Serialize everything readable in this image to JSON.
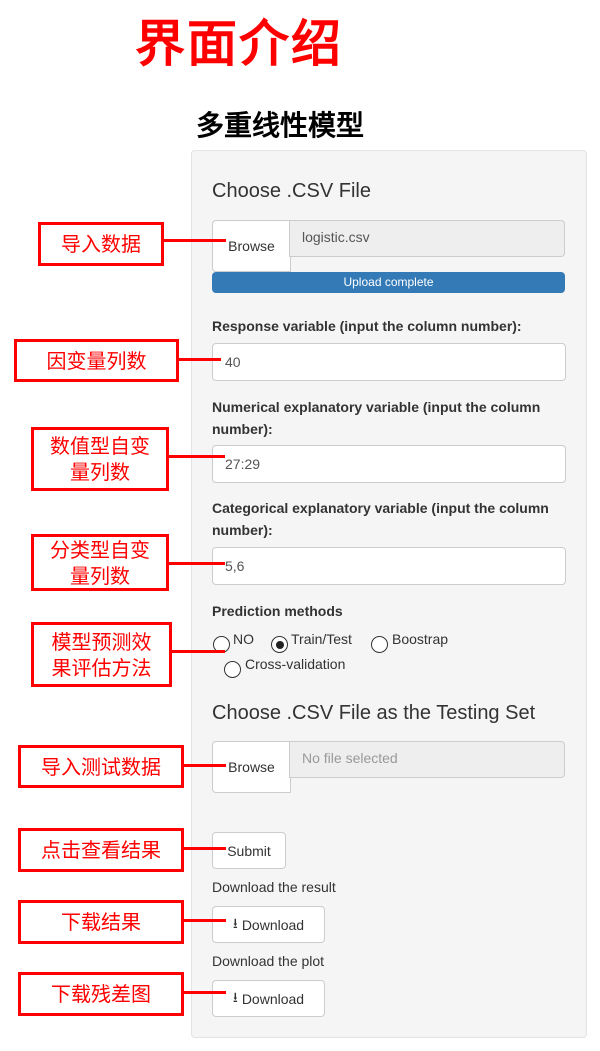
{
  "title": "界面介绍",
  "subtitle": "多重线性模型",
  "upload": {
    "heading": "Choose .CSV File",
    "browse": "Browse",
    "filename": "logistic.csv",
    "progress_text": "Upload complete",
    "progress": 100,
    "progress_color": "#337ab7"
  },
  "response": {
    "label": "Response variable (input the column number):",
    "value": "40"
  },
  "numerical": {
    "label": "Numerical explanatory variable (input the column number):",
    "value": "27:29"
  },
  "categorical": {
    "label": "Categorical explanatory variable (input the column number):",
    "value": "5,6"
  },
  "prediction": {
    "label": "Prediction methods",
    "options": [
      "NO",
      "Train/Test",
      "Boostrap",
      "Cross-validation"
    ],
    "selected": "Train/Test"
  },
  "testing": {
    "heading": "Choose .CSV File as the Testing Set",
    "browse": "Browse",
    "placeholder": "No file selected"
  },
  "submit": "Submit",
  "download_result": {
    "label": "Download the result",
    "button": "Download"
  },
  "download_plot": {
    "label": "Download the plot",
    "button": "Download"
  },
  "annotations": [
    "导入数据",
    "因变量列数",
    "数值型自变量列数",
    "分类型自变量列数",
    "模型预测效果评估方法",
    "导入测试数据",
    "点击查看结果",
    "下载结果",
    "下载残差图"
  ]
}
